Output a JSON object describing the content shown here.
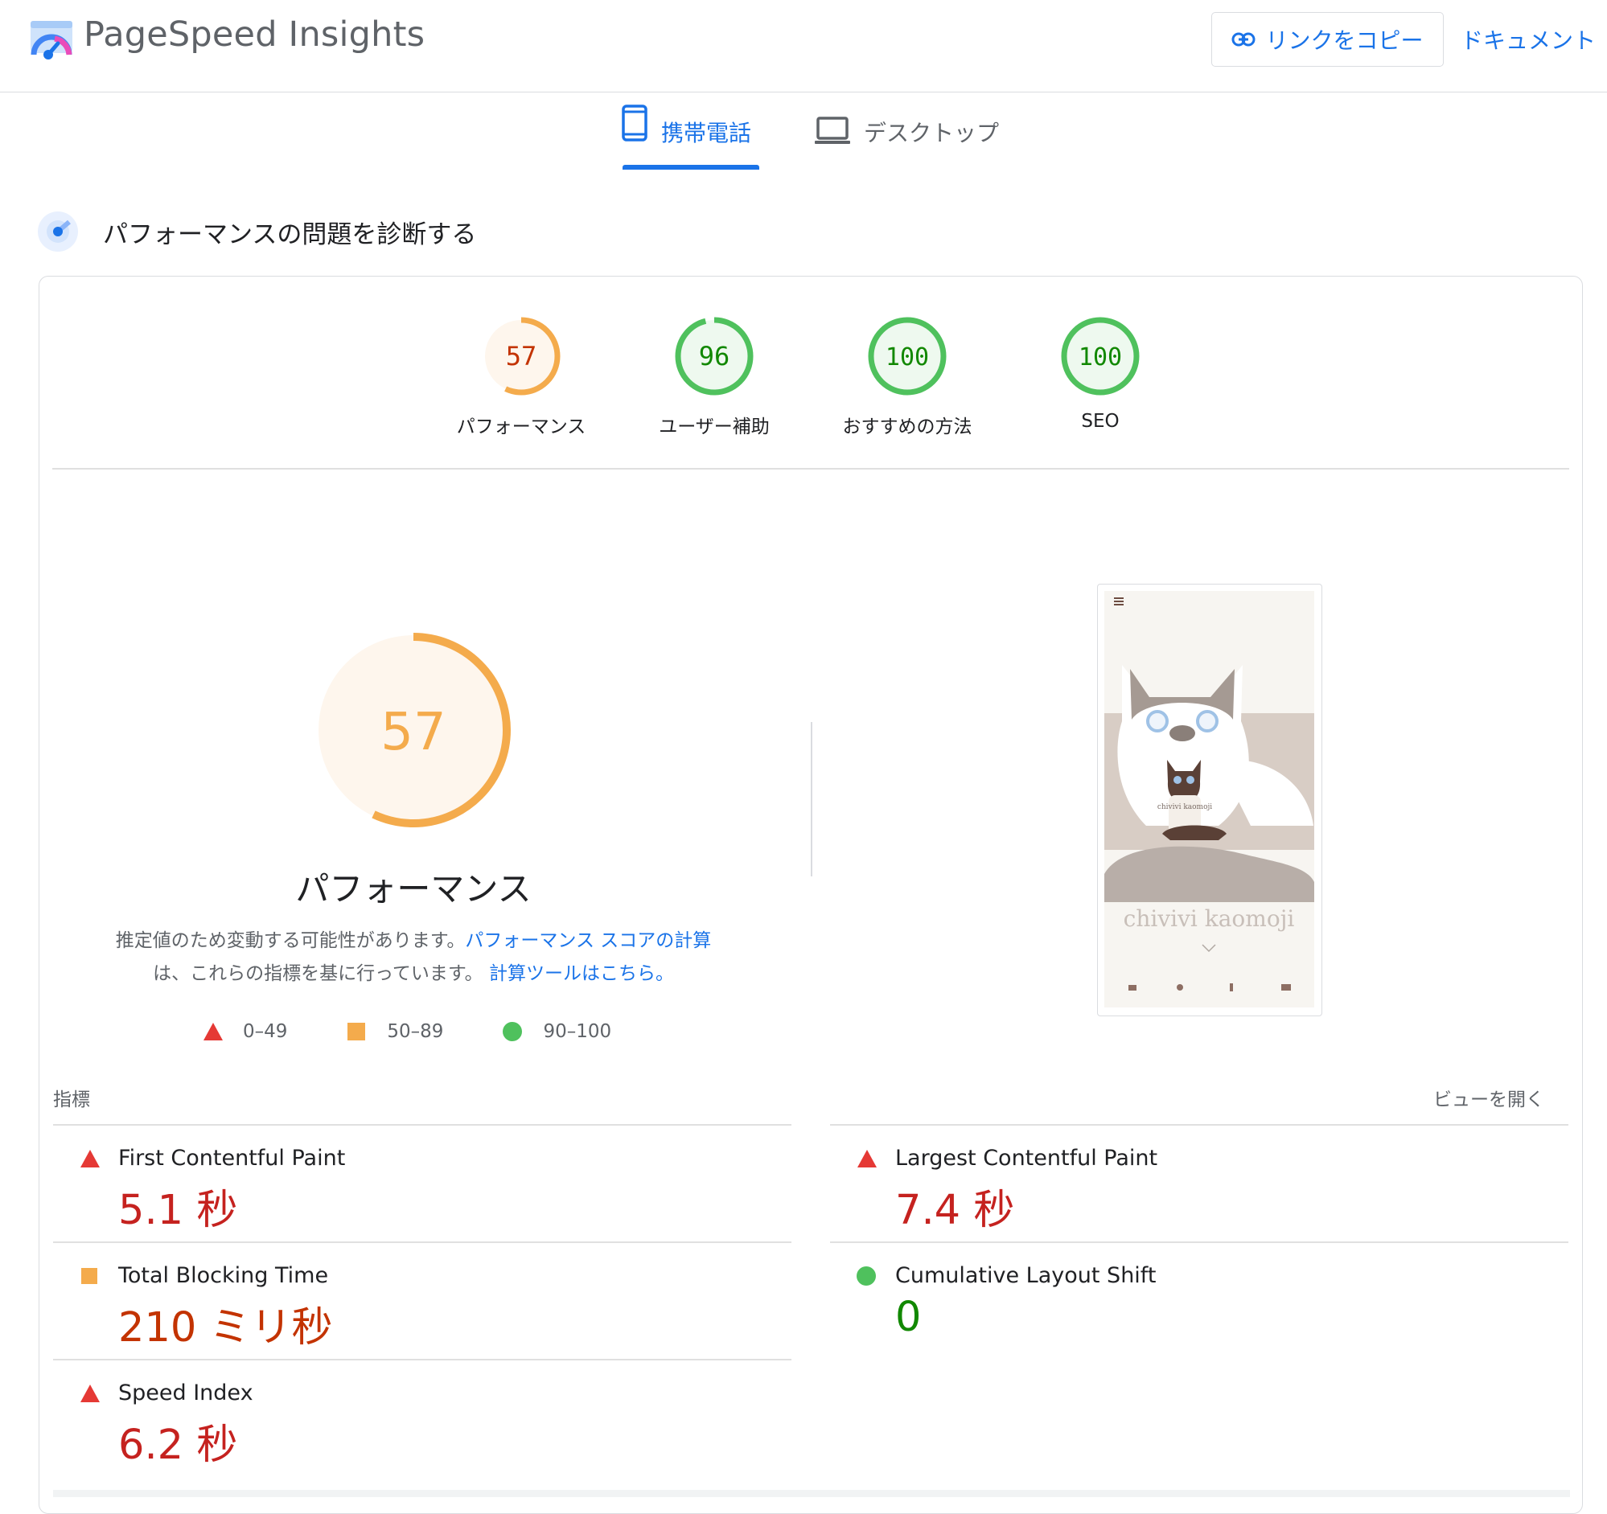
{
  "app": {
    "title": "PageSpeed Insights",
    "copy_link_label": "リンクをコピー",
    "docs_label": "ドキュメント"
  },
  "tabs": {
    "mobile_label": "携帯電話",
    "desktop_label": "デスクトップ",
    "selected": "mobile"
  },
  "diagnose": {
    "title": "パフォーマンスの問題を診断する"
  },
  "scores": [
    {
      "value": "57",
      "label": "パフォーマンス",
      "status": "average"
    },
    {
      "value": "96",
      "label": "ユーザー補助",
      "status": "pass"
    },
    {
      "value": "100",
      "label": "おすすめの方法",
      "status": "pass"
    },
    {
      "value": "100",
      "label": "SEO",
      "status": "pass"
    }
  ],
  "performance": {
    "score": "57",
    "title": "パフォーマンス",
    "desc_part1": "推定値のため変動する可能性があります。",
    "desc_link1": "パフォーマンス スコアの計算",
    "desc_part2": "は、これらの指標を基に行っています。",
    "desc_link2": "計算ツールはこちら。"
  },
  "legend": {
    "fail": "0–49",
    "average": "50–89",
    "pass": "90–100"
  },
  "thumbnail": {
    "brand_text": "chivivi kaomoji",
    "small_brand_text": "chivivi kaomoji"
  },
  "metrics": {
    "section_label": "指標",
    "expand_label": "ビューを開く",
    "items": [
      {
        "name": "First Contentful Paint",
        "value": "5.1 秒",
        "status": "fail"
      },
      {
        "name": "Largest Contentful Paint",
        "value": "7.4 秒",
        "status": "fail"
      },
      {
        "name": "Total Blocking Time",
        "value": "210 ミリ秒",
        "status": "average"
      },
      {
        "name": "Cumulative Layout Shift",
        "value": "0",
        "status": "pass"
      },
      {
        "name": "Speed Index",
        "value": "6.2 秒",
        "status": "fail"
      }
    ]
  },
  "colors": {
    "fail": "#e53935",
    "fail_text": "#c5221f",
    "average": "#f4ab4c",
    "average_text": "#c33300",
    "pass": "#4fc15d",
    "pass_text": "#118800",
    "link": "#1a73e8"
  }
}
